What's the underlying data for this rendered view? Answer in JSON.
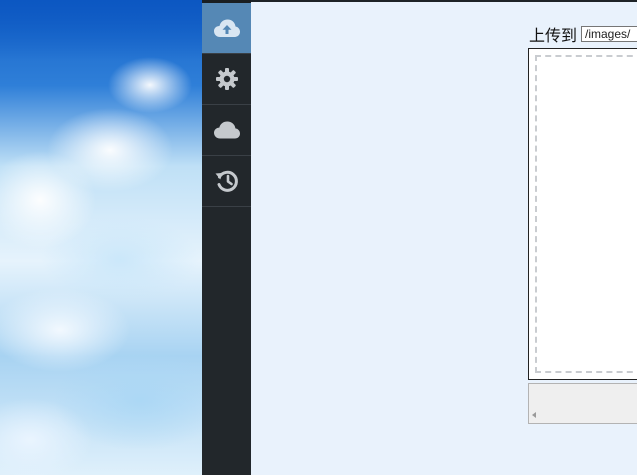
{
  "sidebar": {
    "items": [
      {
        "icon": "cloud-upload-icon",
        "active": true
      },
      {
        "icon": "gear-icon",
        "active": false
      },
      {
        "icon": "cloud-icon",
        "active": false
      },
      {
        "icon": "history-icon",
        "active": false
      }
    ],
    "active_color": "#5588b5",
    "background_color": "#22272b"
  },
  "upload": {
    "label": "上传到",
    "path_value": "/images/"
  },
  "colors": {
    "page_background": "#e9f2fc",
    "icon_color": "#c5c9cd"
  }
}
